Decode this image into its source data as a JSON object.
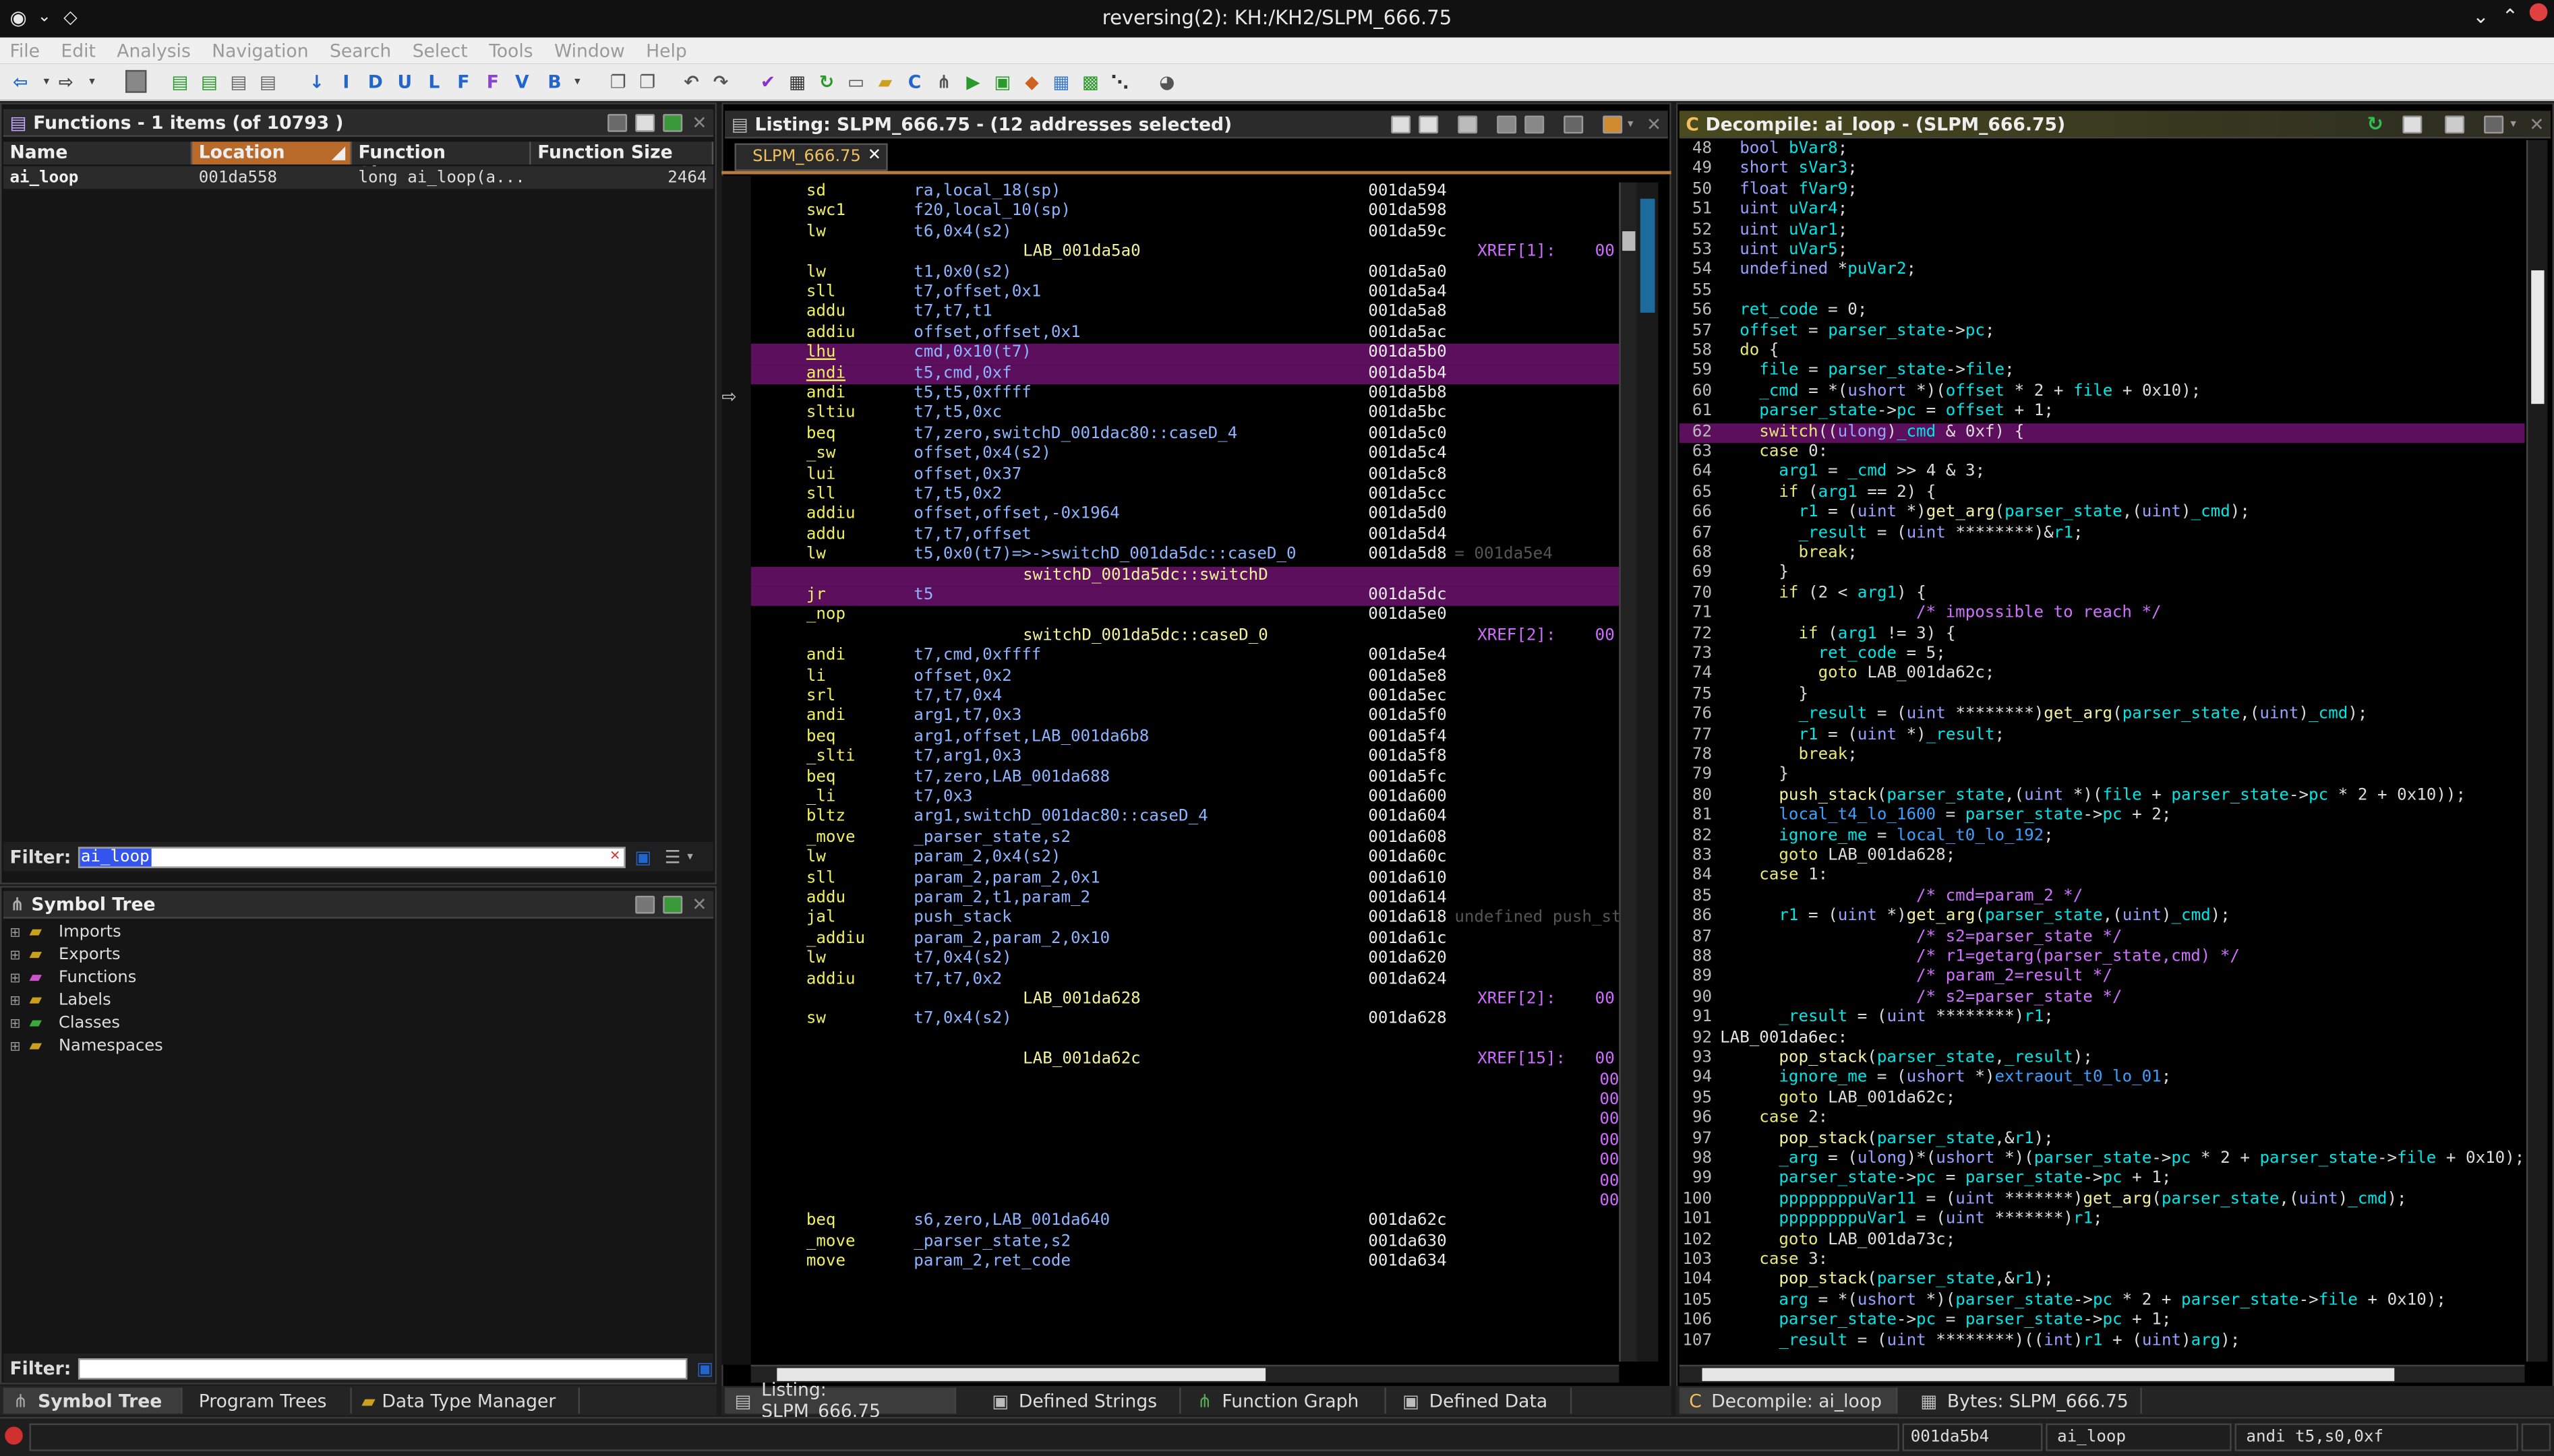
{
  "window": {
    "title": "reversing(2): KH:/KH2/SLPM_666.75"
  },
  "menu": [
    "File",
    "Edit",
    "Analysis",
    "Navigation",
    "Search",
    "Select",
    "Tools",
    "Window",
    "Help"
  ],
  "functions_panel": {
    "title": "Functions - 1 items (of 10793 )",
    "columns": [
      "Name",
      "Location",
      "Function Signature",
      "Function Size"
    ],
    "rows": [
      {
        "name": "ai_loop",
        "location": "001da558",
        "signature": "long ai_loop(a...",
        "size": "2464"
      }
    ],
    "filter_label": "Filter:",
    "filter_value": "ai_loop"
  },
  "symbol_tree": {
    "title": "Symbol Tree",
    "items": [
      "Imports",
      "Exports",
      "Functions",
      "Labels",
      "Classes",
      "Namespaces"
    ],
    "filter_label": "Filter:"
  },
  "left_bottom_tabs": [
    "Symbol Tree",
    "Program Trees",
    "Data Type Manager"
  ],
  "listing": {
    "title": "Listing:  SLPM_666.75 - (12 addresses selected)",
    "tab": "SLPM_666.75",
    "lines": [
      {
        "m": "sd",
        "o": "ra,local_18(sp)",
        "a": "001da594"
      },
      {
        "m": "swc1",
        "o": "f20,local_10(sp)",
        "a": "001da598"
      },
      {
        "m": "lw",
        "o": "t6,0x4(s2)",
        "a": "001da59c"
      },
      {
        "label": "LAB_001da5a0",
        "x": "XREF[1]:    00"
      },
      {
        "m": "lw",
        "o": "t1,0x0(s2)",
        "a": "001da5a0"
      },
      {
        "m": "sll",
        "o": "t7,offset,0x1",
        "a": "001da5a4"
      },
      {
        "m": "addu",
        "o": "t7,t7,t1",
        "a": "001da5a8"
      },
      {
        "m": "addiu",
        "o": "offset,offset,0x1",
        "a": "001da5ac"
      },
      {
        "m": "lhu",
        "o": "cmd,0x10(t7)",
        "a": "001da5b0",
        "hl": true
      },
      {
        "m": "andi",
        "o": "t5,cmd,0xf",
        "a": "001da5b4",
        "hl": true
      },
      {
        "m": "andi",
        "o": "t5,t5,0xffff",
        "a": "001da5b8"
      },
      {
        "m": "sltiu",
        "o": "t7,t5,0xc",
        "a": "001da5bc"
      },
      {
        "m": "beq",
        "o": "t7,zero,switchD_001dac80::caseD_4",
        "a": "001da5c0"
      },
      {
        "m": "_sw",
        "o": "offset,0x4(s2)",
        "a": "001da5c4"
      },
      {
        "m": "lui",
        "o": "offset,0x37",
        "a": "001da5c8"
      },
      {
        "m": "sll",
        "o": "t7,t5,0x2",
        "a": "001da5cc"
      },
      {
        "m": "addiu",
        "o": "offset,offset,-0x1964",
        "a": "001da5d0"
      },
      {
        "m": "addu",
        "o": "t7,t7,offset",
        "a": "001da5d4"
      },
      {
        "m": "lw",
        "o": "t5,0x0(t7)=>->switchD_001da5dc::caseD_0",
        "a": "001da5d8",
        "x": "= 001da5e4"
      },
      {
        "label": "switchD_001da5dc::switchD",
        "hl": true,
        "x": ""
      },
      {
        "m": "jr",
        "o": "t5",
        "a": "001da5dc",
        "hl": true
      },
      {
        "m": "_nop",
        "o": "",
        "a": "001da5e0"
      },
      {
        "label": "switchD_001da5dc::caseD_0",
        "x": "XREF[2]:    00"
      },
      {
        "m": "andi",
        "o": "t7,cmd,0xffff",
        "a": "001da5e4"
      },
      {
        "m": "li",
        "o": "offset,0x2",
        "a": "001da5e8"
      },
      {
        "m": "srl",
        "o": "t7,t7,0x4",
        "a": "001da5ec"
      },
      {
        "m": "andi",
        "o": "arg1,t7,0x3",
        "a": "001da5f0"
      },
      {
        "m": "beq",
        "o": "arg1,offset,LAB_001da6b8",
        "a": "001da5f4"
      },
      {
        "m": "_slti",
        "o": "t7,arg1,0x3",
        "a": "001da5f8"
      },
      {
        "m": "beq",
        "o": "t7,zero,LAB_001da688",
        "a": "001da5fc"
      },
      {
        "m": "_li",
        "o": "t7,0x3",
        "a": "001da600"
      },
      {
        "m": "bltz",
        "o": "arg1,switchD_001dac80::caseD_4",
        "a": "001da604"
      },
      {
        "m": "_move",
        "o": "_parser_state,s2",
        "a": "001da608"
      },
      {
        "m": "lw",
        "o": "param_2,0x4(s2)",
        "a": "001da60c"
      },
      {
        "m": "sll",
        "o": "param_2,param_2,0x1",
        "a": "001da610"
      },
      {
        "m": "addu",
        "o": "param_2,t1,param_2",
        "a": "001da614"
      },
      {
        "m": "jal",
        "o": "push_stack",
        "a": "001da618",
        "x": "undefined push_sta"
      },
      {
        "m": "_addiu",
        "o": "param_2,param_2,0x10",
        "a": "001da61c"
      },
      {
        "m": "lw",
        "o": "t7,0x4(s2)",
        "a": "001da620"
      },
      {
        "m": "addiu",
        "o": "t7,t7,0x2",
        "a": "001da624"
      },
      {
        "label": "LAB_001da628",
        "x": "XREF[2]:    00"
      },
      {
        "m": "sw",
        "o": "t7,0x4(s2)",
        "a": "001da628"
      },
      {
        "blank": true
      },
      {
        "label": "LAB_001da62c",
        "x": "XREF[15]:   00"
      },
      {
        "cont": "00"
      },
      {
        "cont": "00"
      },
      {
        "cont": "00"
      },
      {
        "cont": "00"
      },
      {
        "cont": "00"
      },
      {
        "cont": "00"
      },
      {
        "cont": "00"
      },
      {
        "m": "beq",
        "o": "s6,zero,LAB_001da640",
        "a": "001da62c"
      },
      {
        "m": "_move",
        "o": "_parser_state,s2",
        "a": "001da630"
      },
      {
        "m": "move",
        "o": "param_2,ret_code",
        "a": "001da634"
      }
    ]
  },
  "middle_bottom_tabs": [
    "Listing:  SLPM_666.75",
    "Defined Strings",
    "Function Graph",
    "Defined Data"
  ],
  "decompile": {
    "title": "Decompile: ai_loop -  (SLPM_666.75)",
    "lines": [
      {
        "n": "48",
        "t": "  bool bVar8;"
      },
      {
        "n": "49",
        "t": "  short sVar3;"
      },
      {
        "n": "50",
        "t": "  float fVar9;"
      },
      {
        "n": "51",
        "t": "  uint uVar4;"
      },
      {
        "n": "52",
        "t": "  uint uVar1;"
      },
      {
        "n": "53",
        "t": "  uint uVar5;"
      },
      {
        "n": "54",
        "t": "  undefined *puVar2;"
      },
      {
        "n": "55",
        "t": ""
      },
      {
        "n": "56",
        "t": "  ret_code = 0;"
      },
      {
        "n": "57",
        "t": "  offset = parser_state->pc;"
      },
      {
        "n": "58",
        "t": "  do {"
      },
      {
        "n": "59",
        "t": "    file = parser_state->file;"
      },
      {
        "n": "60",
        "t": "    _cmd = *(ushort *)(offset * 2 + file + 0x10);"
      },
      {
        "n": "61",
        "t": "    parser_state->pc = offset + 1;"
      },
      {
        "n": "62",
        "t": "    switch((ulong)_cmd & 0xf) {",
        "hl": true
      },
      {
        "n": "63",
        "t": "    case 0:"
      },
      {
        "n": "64",
        "t": "      arg1 = _cmd >> 4 & 3;"
      },
      {
        "n": "65",
        "t": "      if (arg1 == 2) {"
      },
      {
        "n": "66",
        "t": "        r1 = (uint *)get_arg(parser_state,(uint)_cmd);"
      },
      {
        "n": "67",
        "t": "        _result = (uint ********)&r1;"
      },
      {
        "n": "68",
        "t": "        break;"
      },
      {
        "n": "69",
        "t": "      }"
      },
      {
        "n": "70",
        "t": "      if (2 < arg1) {"
      },
      {
        "n": "71",
        "t": "                    /* impossible to reach */"
      },
      {
        "n": "72",
        "t": "        if (arg1 != 3) {"
      },
      {
        "n": "73",
        "t": "          ret_code = 5;"
      },
      {
        "n": "74",
        "t": "          goto LAB_001da62c;"
      },
      {
        "n": "75",
        "t": "        }"
      },
      {
        "n": "76",
        "t": "        _result = (uint ********)get_arg(parser_state,(uint)_cmd);"
      },
      {
        "n": "77",
        "t": "        r1 = (uint *)_result;"
      },
      {
        "n": "78",
        "t": "        break;"
      },
      {
        "n": "79",
        "t": "      }"
      },
      {
        "n": "80",
        "t": "      push_stack(parser_state,(uint *)(file + parser_state->pc * 2 + 0x10));"
      },
      {
        "n": "81",
        "t": "      local_t4_lo_1600 = parser_state->pc + 2;"
      },
      {
        "n": "82",
        "t": "      ignore_me = local_t0_lo_192;"
      },
      {
        "n": "83",
        "t": "      goto LAB_001da628;"
      },
      {
        "n": "84",
        "t": "    case 1:"
      },
      {
        "n": "85",
        "t": "                    /* cmd=param_2 */"
      },
      {
        "n": "86",
        "t": "      r1 = (uint *)get_arg(parser_state,(uint)_cmd);"
      },
      {
        "n": "87",
        "t": "                    /* s2=parser_state */"
      },
      {
        "n": "88",
        "t": "                    /* r1=getarg(parser_state,cmd) */"
      },
      {
        "n": "89",
        "t": "                    /* param_2=result */"
      },
      {
        "n": "90",
        "t": "                    /* s2=parser_state */"
      },
      {
        "n": "91",
        "t": "      _result = (uint ********)r1;"
      },
      {
        "n": "92",
        "t": "LAB_001da6ec:",
        "lbl": true
      },
      {
        "n": "93",
        "t": "      pop_stack(parser_state,_result);"
      },
      {
        "n": "94",
        "t": "      ignore_me = (ushort *)extraout_t0_lo_01;"
      },
      {
        "n": "95",
        "t": "      goto LAB_001da62c;"
      },
      {
        "n": "96",
        "t": "    case 2:"
      },
      {
        "n": "97",
        "t": "      pop_stack(parser_state,&r1);"
      },
      {
        "n": "98",
        "t": "      _arg = (ulong)*(ushort *)(parser_state->pc * 2 + parser_state->file + 0x10);"
      },
      {
        "n": "99",
        "t": "      parser_state->pc = parser_state->pc + 1;"
      },
      {
        "n": "100",
        "t": "      ppppppppuVar11 = (uint *******)get_arg(parser_state,(uint)_cmd);"
      },
      {
        "n": "101",
        "t": "      ppppppppuVar1 = (uint *******)r1;"
      },
      {
        "n": "102",
        "t": "      goto LAB_001da73c;"
      },
      {
        "n": "103",
        "t": "    case 3:"
      },
      {
        "n": "104",
        "t": "      pop_stack(parser_state,&r1);"
      },
      {
        "n": "105",
        "t": "      arg = *(ushort *)(parser_state->pc * 2 + parser_state->file + 0x10);"
      },
      {
        "n": "106",
        "t": "      parser_state->pc = parser_state->pc + 1;"
      },
      {
        "n": "107",
        "t": "      _result = (uint ********)((int)r1 + (uint)arg);"
      }
    ]
  },
  "right_bottom_tabs": [
    "Decompile: ai_loop",
    "Bytes: SLPM_666.75"
  ],
  "status": {
    "address": "001da5b4",
    "function": "ai_loop",
    "instruction": "andi t5,s0,0xf"
  }
}
